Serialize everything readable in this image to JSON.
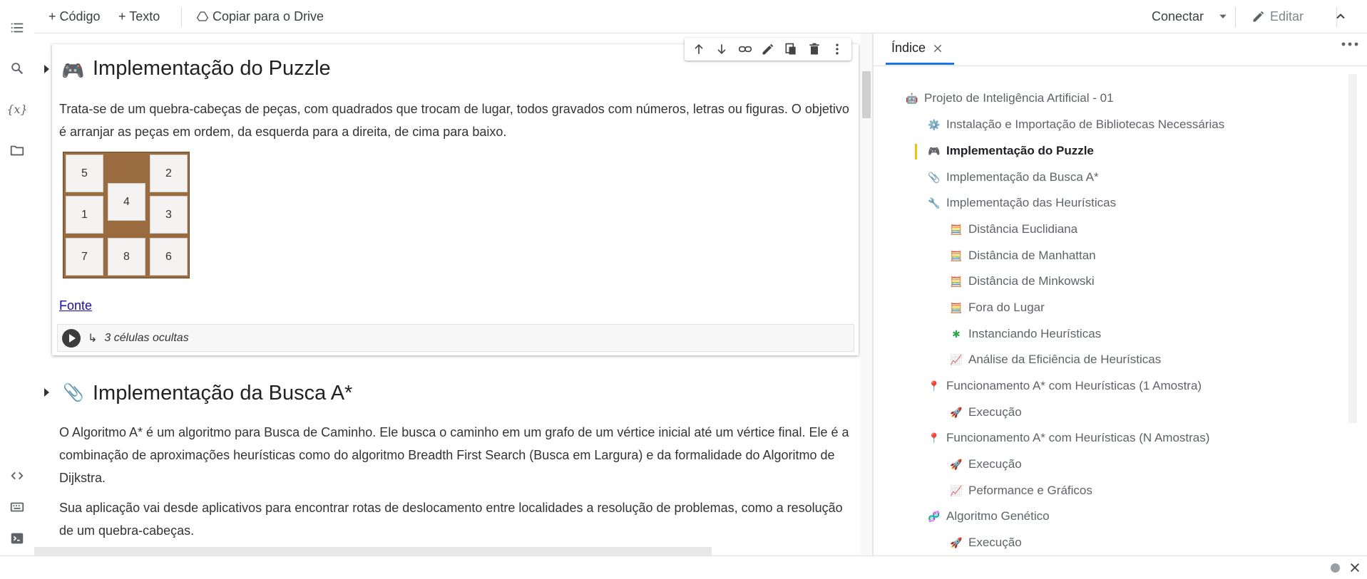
{
  "toolbar": {
    "add_code": "+ Código",
    "add_text": "+ Texto",
    "copy_drive": "Copiar para o Drive",
    "connect": "Conectar",
    "edit": "Editar"
  },
  "cell1": {
    "title": "Implementação do Puzzle",
    "paragraph": "Trata-se de um quebra-cabeças de peças, com quadrados que trocam de lugar, todos gravados com números, letras ou figuras. O objetivo é arranjar as peças em ordem, da esquerda para a direita, de cima para baixo.",
    "tiles": [
      "5",
      "2",
      "4",
      "1",
      "3",
      "7",
      "8",
      "6"
    ],
    "link": "Fonte",
    "hidden_cells": "3 células ocultas"
  },
  "cell2": {
    "title": "Implementação da Busca A*",
    "paragraph1": "O Algoritmo A* é um algoritmo para Busca de Caminho. Ele busca o caminho em um grafo de um vértice inicial até um vértice final. Ele é a combinação de aproximações heurísticas como do algoritmo Breadth First Search (Busca em Largura) e da formalidade do Algoritmo de Dijkstra.",
    "paragraph2": "Sua aplicação vai desde aplicativos para encontrar rotas de deslocamento entre localidades a resolução de problemas, como a resolução de um quebra-cabeças."
  },
  "toc": {
    "tab_label": "Índice",
    "items": [
      {
        "label": "Projeto de Inteligência Artificial - 01",
        "icon": "robot-icon"
      },
      {
        "label": "Instalação e Importação de Bibliotecas Necessárias",
        "icon": "gear-icon"
      },
      {
        "label": "Implementação do Puzzle",
        "icon": "gamepad-icon"
      },
      {
        "label": "Implementação da Busca A*",
        "icon": "paperclip-icon"
      },
      {
        "label": "Implementação das Heurísticas",
        "icon": "wrench-icon"
      },
      {
        "label": "Distância Euclidiana",
        "icon": "abacus-icon"
      },
      {
        "label": "Distância de Manhattan",
        "icon": "abacus-icon"
      },
      {
        "label": "Distância de Minkowski",
        "icon": "abacus-icon"
      },
      {
        "label": "Fora do Lugar",
        "icon": "abacus-icon"
      },
      {
        "label": "Instanciando Heurísticas",
        "icon": "puzzle-icon"
      },
      {
        "label": "Análise da Eficiência de Heurísticas",
        "icon": "chart-icon"
      },
      {
        "label": "Funcionamento A* com Heurísticas (1 Amostra)",
        "icon": "pushpin-icon"
      },
      {
        "label": "Execução",
        "icon": "rocket-icon"
      },
      {
        "label": "Funcionamento A* com Heurísticas (N Amostras)",
        "icon": "pushpin-icon"
      },
      {
        "label": "Execução",
        "icon": "rocket-icon"
      },
      {
        "label": "Peformance e Gráficos",
        "icon": "chart-icon"
      },
      {
        "label": "Algoritmo Genético",
        "icon": "dna-icon"
      },
      {
        "label": "Execução",
        "icon": "rocket-icon"
      }
    ]
  },
  "colors": {
    "accent": "#1a73e8",
    "active_marker": "#f4c20d",
    "link": "#1a0dab"
  }
}
